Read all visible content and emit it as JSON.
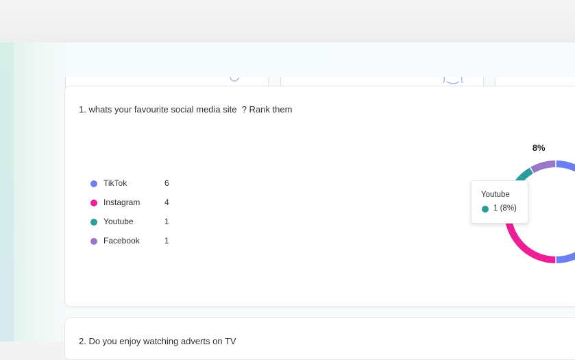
{
  "question1": {
    "title": "1. whats your favourite social media site  ? Rank them",
    "legend": [
      {
        "label": "TikTok",
        "count": "6",
        "color": "#6b7ff0"
      },
      {
        "label": "Instagram",
        "count": "4",
        "color": "#ee1f96"
      },
      {
        "label": "Youtube",
        "count": "1",
        "color": "#2b9c9c"
      },
      {
        "label": "Facebook",
        "count": "1",
        "color": "#9a78c8"
      }
    ],
    "tooltip": {
      "name": "Youtube",
      "value": "1 (8%)",
      "color": "#2b9c9c"
    }
  },
  "chart_data": {
    "type": "pie",
    "categories": [
      "TikTok",
      "Instagram",
      "Youtube",
      "Facebook"
    ],
    "values": [
      6,
      4,
      1,
      1
    ],
    "labels": [
      "",
      "33%",
      "8%",
      "8%"
    ],
    "colors": [
      "#6b7ff0",
      "#ee1f96",
      "#2b9c9c",
      "#9a78c8"
    ]
  },
  "question2": {
    "title": "2. Do you enjoy watching adverts on TV"
  }
}
